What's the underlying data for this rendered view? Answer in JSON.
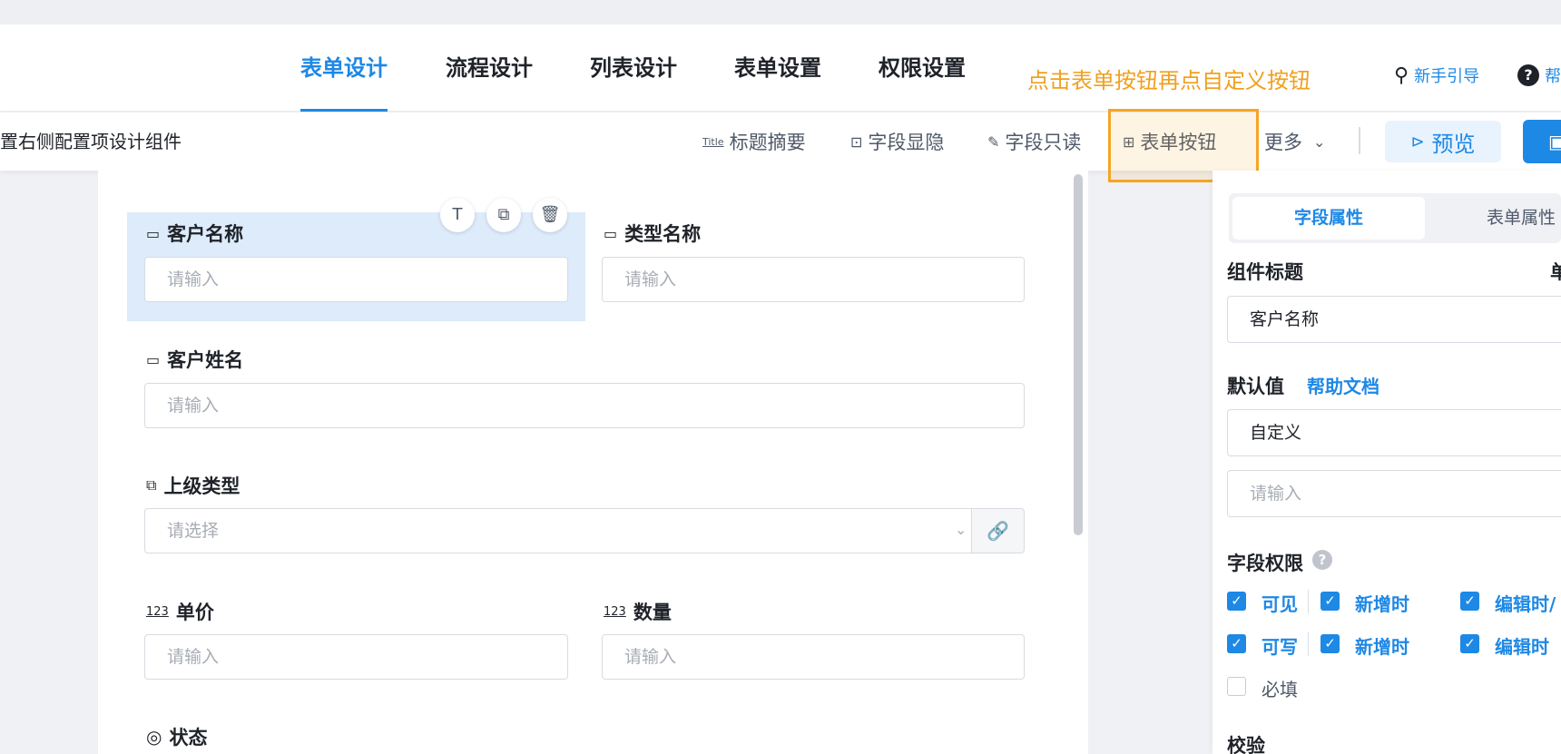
{
  "tabs": [
    "表单设计",
    "流程设计",
    "列表设计",
    "表单设置",
    "权限设置"
  ],
  "hint": "点击表单按钮再点自定义按钮",
  "topright": {
    "guide_label": "新手引导",
    "help_label": "帮",
    "help_icon": "?"
  },
  "toolbar": {
    "description": "置右侧配置项设计组件",
    "items": [
      {
        "icon": "title-icon",
        "glyph": "Title",
        "label": "标题摘要"
      },
      {
        "icon": "field-visibility-icon",
        "glyph": "⊡",
        "label": "字段显隐"
      },
      {
        "icon": "readonly-icon",
        "glyph": "✎",
        "label": "字段只读"
      },
      {
        "icon": "form-button-icon",
        "glyph": "⊞",
        "label": "表单按钮"
      },
      {
        "icon": "chevron-down-icon",
        "glyph": "⌄",
        "label": "更多"
      }
    ],
    "preview_label": "预览",
    "save_icon": "save-icon"
  },
  "form": {
    "fields": [
      {
        "label": "客户名称",
        "placeholder": "请输入",
        "icon": "▭"
      },
      {
        "label": "类型名称",
        "placeholder": "请输入",
        "icon": "▭"
      },
      {
        "label": "客户姓名",
        "placeholder": "请输入",
        "icon": "▭"
      },
      {
        "label": "上级类型",
        "placeholder": "请选择",
        "icon": "⧉"
      },
      {
        "label": "单价",
        "placeholder": "请输入",
        "icon": "123"
      },
      {
        "label": "数量",
        "placeholder": "请输入",
        "icon": "123"
      },
      {
        "label": "状态",
        "icon": "◎"
      }
    ],
    "chip_icons": [
      "T",
      "⧉",
      "🗑"
    ]
  },
  "panel": {
    "tabs": [
      "字段属性",
      "表单属性"
    ],
    "component_title_label": "组件标题",
    "component_title_suffix": "单",
    "component_title_value": "客户名称",
    "default_label": "默认值",
    "help_doc": "帮助文档",
    "default_mode": "自定义",
    "default_placeholder": "请输入",
    "permission_label": "字段权限",
    "perm_rows": [
      {
        "main": "可见",
        "a": "新增时",
        "b": "编辑时/"
      },
      {
        "main": "可写",
        "a": "新增时",
        "b": "编辑时"
      }
    ],
    "required_label": "必填",
    "validate_label": "校验"
  },
  "colors": {
    "accent": "#1e88e5",
    "hint": "#f0a020",
    "highlight": "#f5a524"
  }
}
